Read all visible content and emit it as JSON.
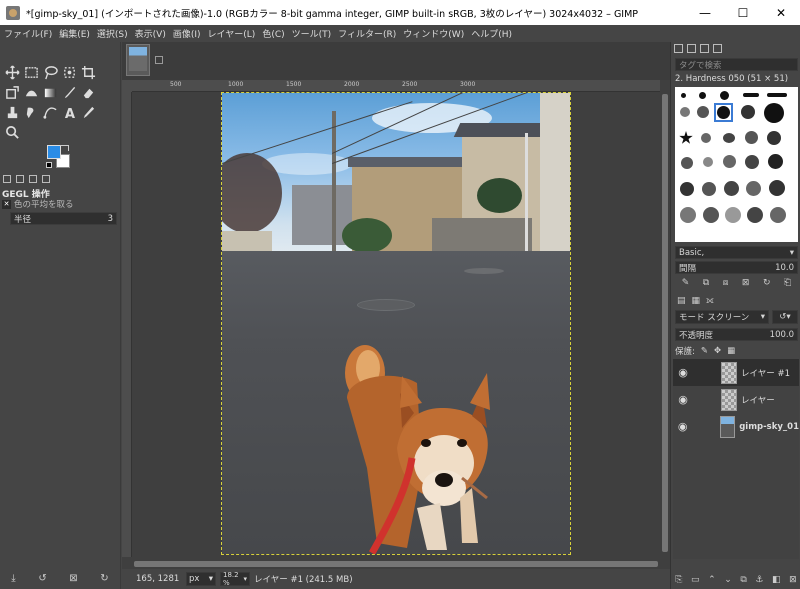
{
  "window": {
    "title": "*[gimp-sky_01] (インポートされた画像)-1.0 (RGBカラー 8-bit gamma integer, GIMP built-in sRGB, 3枚のレイヤー) 3024x4032 – GIMP",
    "minimize": "—",
    "maximize": "☐",
    "close": "✕"
  },
  "menu": [
    "ファイル(F)",
    "編集(E)",
    "選択(S)",
    "表示(V)",
    "画像(I)",
    "レイヤー(L)",
    "色(C)",
    "ツール(T)",
    "フィルター(R)",
    "ウィンドウ(W)",
    "ヘルプ(H)"
  ],
  "tool_options": {
    "title": "GEGL 操作",
    "subtitle": "色の平均を取る",
    "radius_label": "半径",
    "radius_value": "3"
  },
  "colors": {
    "foreground": "#2a8ce6",
    "background": "#ffffff"
  },
  "ruler": {
    "labels": [
      "500",
      "1000",
      "1500",
      "2000",
      "2500",
      "3000"
    ]
  },
  "brushes": {
    "search_placeholder": "タグで検索",
    "selected_brush": "2. Hardness 050 (51 × 51)",
    "preset": "Basic,",
    "spacing_label": "間隔",
    "spacing_value": "10.0"
  },
  "layers_panel": {
    "mode": "モード スクリーン",
    "opacity_label": "不透明度",
    "opacity_value": "100.0",
    "lock_label": "保護:",
    "layers": [
      {
        "name": "レイヤー #1",
        "active": true,
        "thumb": "transparent"
      },
      {
        "name": "レイヤー",
        "active": false,
        "thumb": "sky"
      },
      {
        "name": "gimp-sky_01",
        "active": false,
        "thumb": "photo"
      }
    ]
  },
  "status": {
    "coords": "165, 1281",
    "unit": "px",
    "zoom": "18.2 %",
    "layer_info": "レイヤー #1 (241.5 MB)"
  }
}
